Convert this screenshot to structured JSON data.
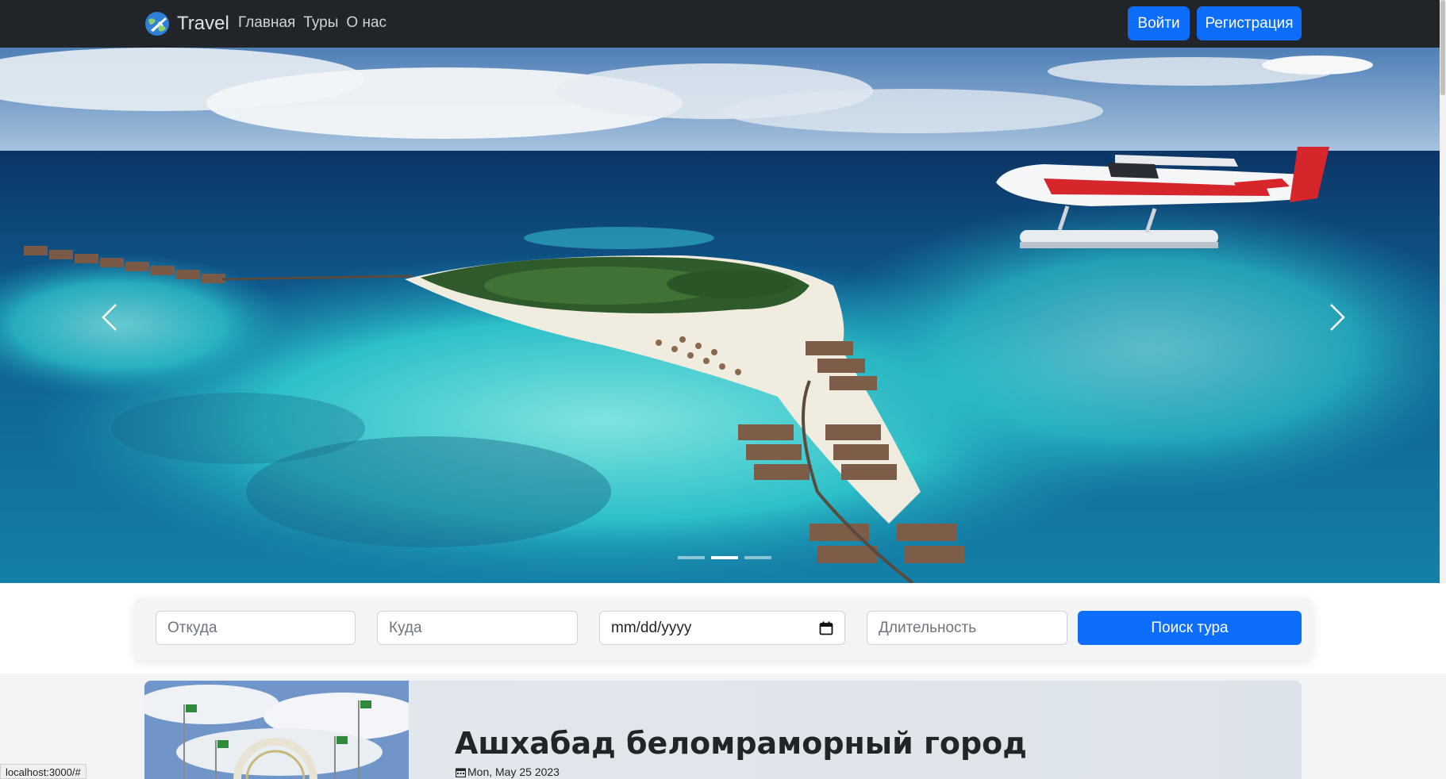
{
  "navbar": {
    "brand": "Travel",
    "links": [
      "Главная",
      "Туры",
      "О нас"
    ],
    "login_label": "Войти",
    "register_label": "Регистрация"
  },
  "carousel": {
    "slide_count": 3,
    "active_index": 1
  },
  "search": {
    "from_placeholder": "Откуда",
    "to_placeholder": "Куда",
    "date_value": "mm/dd/yyyy",
    "duration_placeholder": "Длительность",
    "submit_label": "Поиск тура"
  },
  "article": {
    "title": "Ашхабад беломраморный город",
    "date": "Mon, May 25 2023"
  },
  "status_bar": {
    "url": "localhost:3000/#"
  },
  "colors": {
    "navbar_bg": "#212529",
    "primary": "#0d6efd"
  }
}
